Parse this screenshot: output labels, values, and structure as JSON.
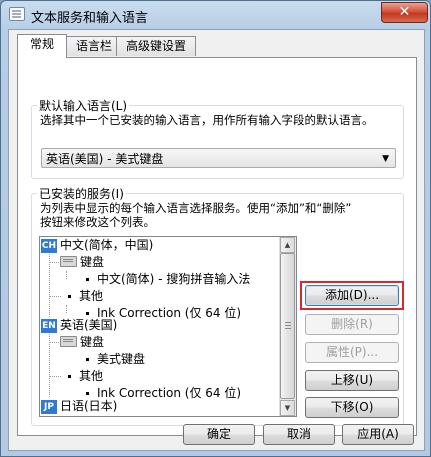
{
  "window": {
    "title": "文本服务和输入语言",
    "close_label": "✕"
  },
  "tabs": [
    {
      "label": "常规",
      "active": true
    },
    {
      "label": "语言栏",
      "active": false
    },
    {
      "label": "高级键设置",
      "active": false
    }
  ],
  "default_language": {
    "group_label": "默认输入语言(L)",
    "description": "选择其中一个已安装的输入语言，用作所有输入字段的默认语言。",
    "selected": "英语(美国) - 美式键盘"
  },
  "installed_services": {
    "group_label": "已安装的服务(I)",
    "description_line1": "为列表中显示的每个输入语言选择服务。使用“添加”和“删除”",
    "description_line2": "按钮来修改这个列表。",
    "tree": [
      {
        "type": "lang",
        "badge": "CH",
        "label": "中文(简体，中国)"
      },
      {
        "type": "category",
        "icon": "keyboard-icon",
        "label": "键盘"
      },
      {
        "type": "item",
        "label": "中文(简体) - 搜狗拼音输入法"
      },
      {
        "type": "category",
        "label": "其他"
      },
      {
        "type": "item",
        "label": "Ink Correction (仅 64 位)"
      },
      {
        "type": "lang",
        "badge": "EN",
        "label": "英语(美国)"
      },
      {
        "type": "category",
        "icon": "keyboard-icon",
        "label": "键盘"
      },
      {
        "type": "item",
        "label": "美式键盘"
      },
      {
        "type": "category",
        "label": "其他"
      },
      {
        "type": "item",
        "label": "Ink Correction (仅 64 位)"
      },
      {
        "type": "lang",
        "badge": "JP",
        "label": "日语(日本)"
      }
    ],
    "buttons": {
      "add": "添加(D)...",
      "remove": "删除(R)",
      "properties": "属性(P)...",
      "move_up": "上移(U)",
      "move_down": "下移(O)"
    }
  },
  "footer": {
    "ok": "确定",
    "cancel": "取消",
    "apply": "应用(A)"
  },
  "colors": {
    "badge": "#2f7bd1",
    "highlight": "#d6282e"
  }
}
